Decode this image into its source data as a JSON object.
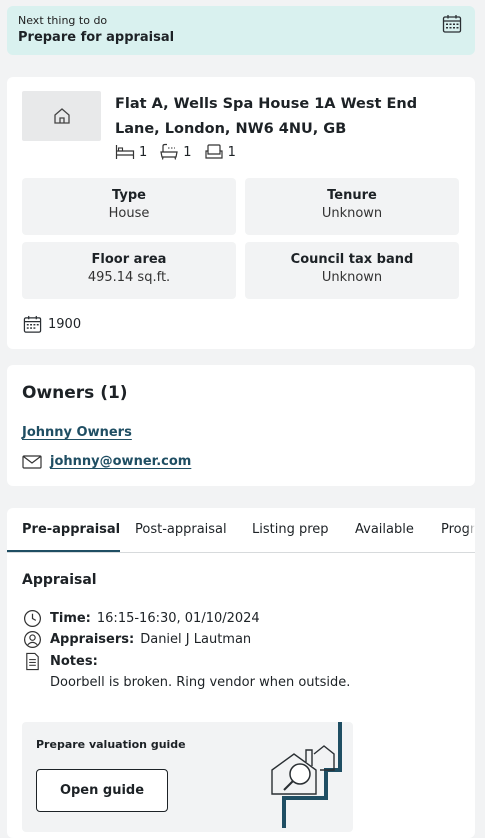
{
  "banner": {
    "subtitle": "Next thing to do",
    "title": "Prepare for appraisal"
  },
  "property": {
    "address": "Flat A, Wells Spa House 1A West End Lane, London, NW6 4NU, GB",
    "bedrooms": "1",
    "bathrooms": "1",
    "receptions": "1",
    "type_label": "Type",
    "type_value": "House",
    "tenure_label": "Tenure",
    "tenure_value": "Unknown",
    "area_label": "Floor area",
    "area_value": "495.14 sq.ft.",
    "council_label": "Council tax band",
    "council_value": "Unknown",
    "year": "1900"
  },
  "owners": {
    "title": "Owners (1)",
    "name": "Johnny Owners",
    "email": "johnny@owner.com"
  },
  "tabs": [
    {
      "label": "Pre-appraisal",
      "active": true
    },
    {
      "label": "Post-appraisal"
    },
    {
      "label": "Listing prep"
    },
    {
      "label": "Available"
    },
    {
      "label": "Progr"
    }
  ],
  "appraisal": {
    "title": "Appraisal",
    "time_label": "Time:",
    "time_value": "16:15-16:30, 01/10/2024",
    "appraisers_label": "Appraisers:",
    "appraisers_value": "Daniel J Lautman",
    "notes_label": "Notes:",
    "notes_value": "Doorbell is broken. Ring vendor when outside."
  },
  "guide": {
    "title": "Prepare valuation guide",
    "button": "Open guide"
  },
  "icons": {
    "banner": "calendar-icon",
    "thumb": "home-icon",
    "bed": "bed-icon",
    "bath": "bath-icon",
    "sofa": "sofa-icon",
    "year": "calendar-icon",
    "mail": "mail-icon",
    "time": "clock-icon",
    "appraisers": "user-icon",
    "notes": "document-icon"
  },
  "colors": {
    "banner_bg": "#d9f1ef",
    "link": "#1f4e63",
    "tab_active": "#1f4e63",
    "page_bg": "#f2f3f4"
  }
}
